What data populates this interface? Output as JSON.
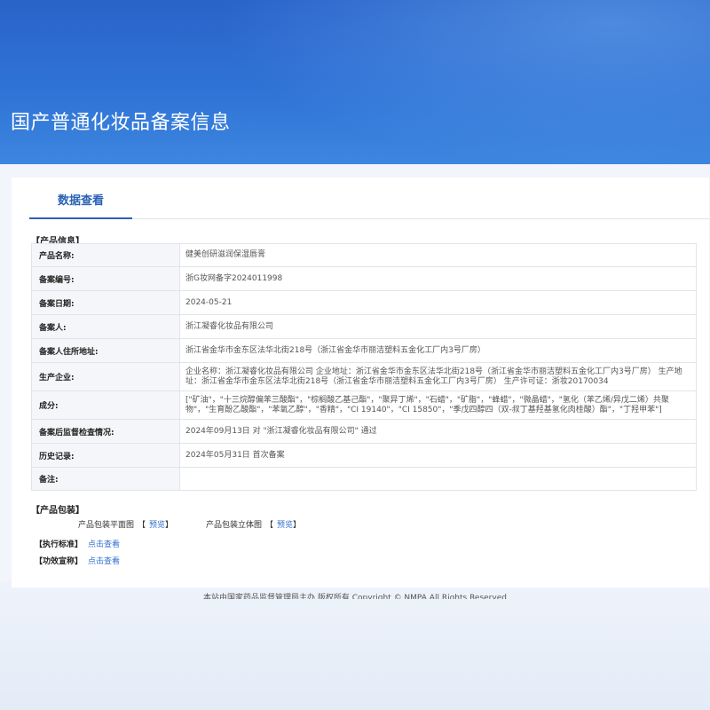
{
  "header": {
    "title": "国产普通化妆品备案信息"
  },
  "tabs": [
    {
      "label": "数据查看"
    }
  ],
  "sections": {
    "product_info": "【产品信息】",
    "packaging": "【产品包装】",
    "standard": "【执行标准】",
    "efficacy": "【功效宣称】"
  },
  "product": {
    "rows": [
      {
        "label": "产品名称:",
        "value": "健美创研滋润保湿唇膏"
      },
      {
        "label": "备案编号:",
        "value": "浙G妆网备字2024011998"
      },
      {
        "label": "备案日期:",
        "value": "2024-05-21"
      },
      {
        "label": "备案人:",
        "value": "浙江凝睿化妆品有限公司"
      },
      {
        "label": "备案人住所地址:",
        "value": "浙江省金华市金东区法华北街218号（浙江省金华市丽洁塑料五金化工厂内3号厂房）"
      },
      {
        "label": "生产企业:",
        "value": "企业名称：浙江凝睿化妆品有限公司 企业地址：浙江省金华市金东区法华北街218号（浙江省金华市丽洁塑料五金化工厂内3号厂房） 生产地址：浙江省金华市金东区法华北街218号（浙江省金华市丽洁塑料五金化工厂内3号厂房） 生产许可证：浙妆20170034"
      },
      {
        "label": "成分:",
        "value": "[\"矿油\"，\"十三烷醇偏苯三酸酯\"，\"棕榈酸乙基己酯\"，\"聚异丁烯\"，\"石蜡\"，\"矿脂\"，\"蜂蜡\"，\"微晶蜡\"，\"氢化（苯乙烯/异戊二烯）共聚物\"，\"生育酚乙酸酯\"，\"苯氧乙醇\"，\"香精\"，\"CI 19140\"，\"CI 15850\"，\"季戊四醇四（双-叔丁基羟基氢化肉桂酸）酯\"，\"丁羟甲苯\"]"
      },
      {
        "label": "备案后监督检查情况:",
        "value": "2024年09月13日 对 \"浙江凝睿化妆品有限公司\" 通过"
      },
      {
        "label": "历史记录:",
        "value": "2024年05月31日 首次备案"
      },
      {
        "label": "备注:",
        "value": ""
      }
    ]
  },
  "packaging": {
    "flat_label": "产品包装平面图",
    "solid_label": "产品包装立体图",
    "preview_link": "预览",
    "bracket_open": "【",
    "bracket_close": "】"
  },
  "standard": {
    "link": "点击查看"
  },
  "efficacy": {
    "link": "点击查看"
  },
  "footer": {
    "text": "本站由国家药品监督管理局主办 版权所有 Copyright © NMPA All Rights Reserved"
  }
}
